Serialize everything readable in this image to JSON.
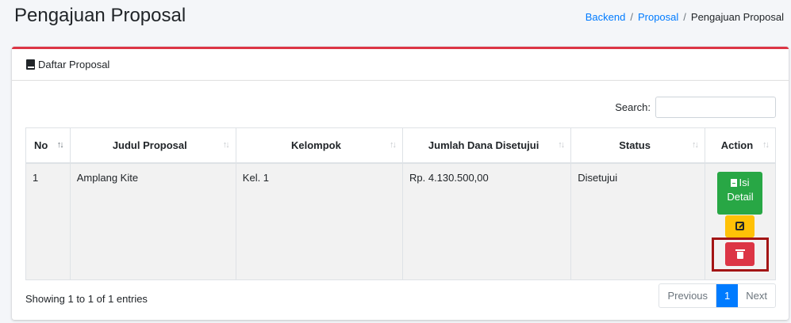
{
  "page": {
    "title": "Pengajuan Proposal"
  },
  "breadcrumb": {
    "items": [
      "Backend",
      "Proposal",
      "Pengajuan Proposal"
    ],
    "sep": "/"
  },
  "card": {
    "title": "Daftar Proposal",
    "accent": "#dc3545"
  },
  "search": {
    "label": "Search:",
    "value": ""
  },
  "table": {
    "columns": [
      "No",
      "Judul Proposal",
      "Kelompok",
      "Jumlah Dana Disetujui",
      "Status",
      "Action"
    ],
    "rows": [
      {
        "no": "1",
        "judul": "Amplang Kite",
        "kelompok": "Kel. 1",
        "dana": "Rp. 4.130.500,00",
        "status": "Disetujui"
      }
    ],
    "detail_label_1": "Isi",
    "detail_label_2": "Detail"
  },
  "footer": {
    "info": "Showing 1 to 1 of 1 entries",
    "prev": "Previous",
    "current": "1",
    "next": "Next"
  },
  "colors": {
    "success": "#28a745",
    "warning": "#ffc107",
    "danger": "#dc3545",
    "primary": "#007bff"
  }
}
